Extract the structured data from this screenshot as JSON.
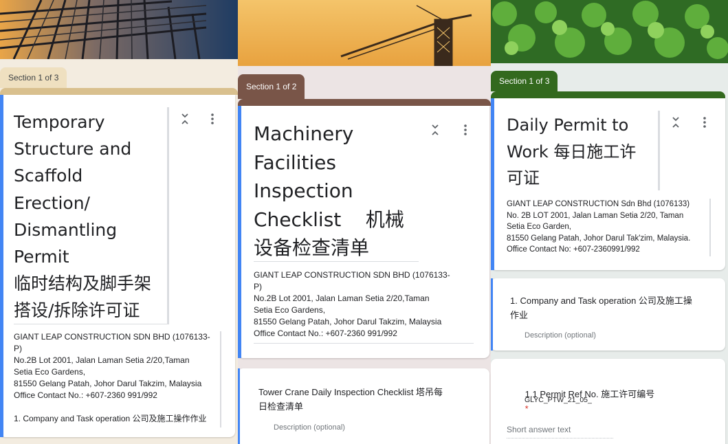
{
  "colors": {
    "panel1_theme": "#d9c08e",
    "panel1_tab": "#efe0c0",
    "panel2_theme": "#795548",
    "panel3_theme": "#33691e",
    "accent_blue": "#4285f4",
    "required_red": "#d93025"
  },
  "panels": [
    {
      "section_tab": "Section 1 of 3",
      "title": "Temporary\nStructure and\nScaffold\nErection/\nDismantling\nPermit\n临时结构及脚手架\n搭设/拆除许可证",
      "description": "GIANT LEAP CONSTRUCTION SDN BHD (1076133-\nP)\nNo.2B Lot 2001, Jalan Laman Setia 2/20,Taman\nSetia Eco Gardens,\n81550 Gelang Patah, Johor Darul Takzim, Malaysia\nOffice Contact No.: +607-2360 991/992\n\n1. Company and Task operation 公司及施工操作作业",
      "icons": {
        "collapse": "collapse-icon",
        "more": "more-vert-icon",
        "banner": "scaffolding-photo"
      }
    },
    {
      "section_tab": "Section 1 of 2",
      "title": "Machinery\nFacilities\nInspection\nChecklist    机械\n设备检查清单",
      "description": "GIANT LEAP CONSTRUCTION SDN BHD (1076133-\nP)\nNo.2B Lot 2001, Jalan Laman Setia 2/20,Taman\nSetia Eco Gardens,\n81550 Gelang Patah, Johor Darul Takzim, Malaysia\nOffice Contact No.: +607-2360 991/992",
      "sub_section": {
        "title": "Tower Crane Daily Inspection Checklist 塔吊每\n日检查清单",
        "description_placeholder": "Description (optional)"
      },
      "icons": {
        "collapse": "collapse-icon",
        "more": "more-vert-icon",
        "banner": "tower-crane-photo"
      }
    },
    {
      "section_tab": "Section 1 of 3",
      "title": "Daily Permit to\nWork 每日施工许\n可证",
      "description": "GIANT LEAP CONSTRUCTION Sdn Bhd (1076133)\nNo. 2B LOT 2001, Jalan Laman Setia 2/20, Taman\nSetia Eco Garden,\n81550 Gelang Patah, Johor Darul Tak'zim, Malaysia.\nOffice Contact No: +607-2360991/992",
      "sub_section": {
        "title": "1. Company and Task operation 公司及施工操\n作业",
        "description_placeholder": "Description (optional)"
      },
      "question": {
        "title": "1.1 Permit Ref No. 施工许可编号",
        "required_mark": "*",
        "description": "GLYC_PTW_21_05_",
        "placeholder": "Short answer text"
      },
      "icons": {
        "collapse": "collapse-icon",
        "more": "more-vert-icon",
        "banner": "clover-leaves-photo"
      }
    }
  ]
}
